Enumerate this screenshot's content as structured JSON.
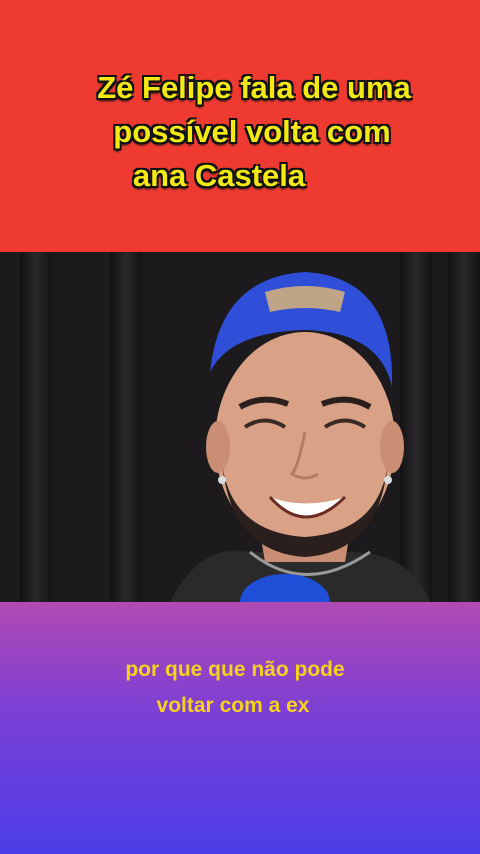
{
  "headline": {
    "line1": "Zé Felipe fala de uma",
    "line2": "possível volta com",
    "line3": "ana Castela"
  },
  "caption": {
    "line1": "por que que não pode",
    "line2": "voltar com a ex"
  },
  "colors": {
    "top_banner": "#ee3a30",
    "headline_text": "#f4ea12",
    "caption_text": "#f6d21c",
    "bottom_gradient_start": "#b14ab3",
    "bottom_gradient_end": "#4b3ee8",
    "cap": "#2f4fd8"
  }
}
